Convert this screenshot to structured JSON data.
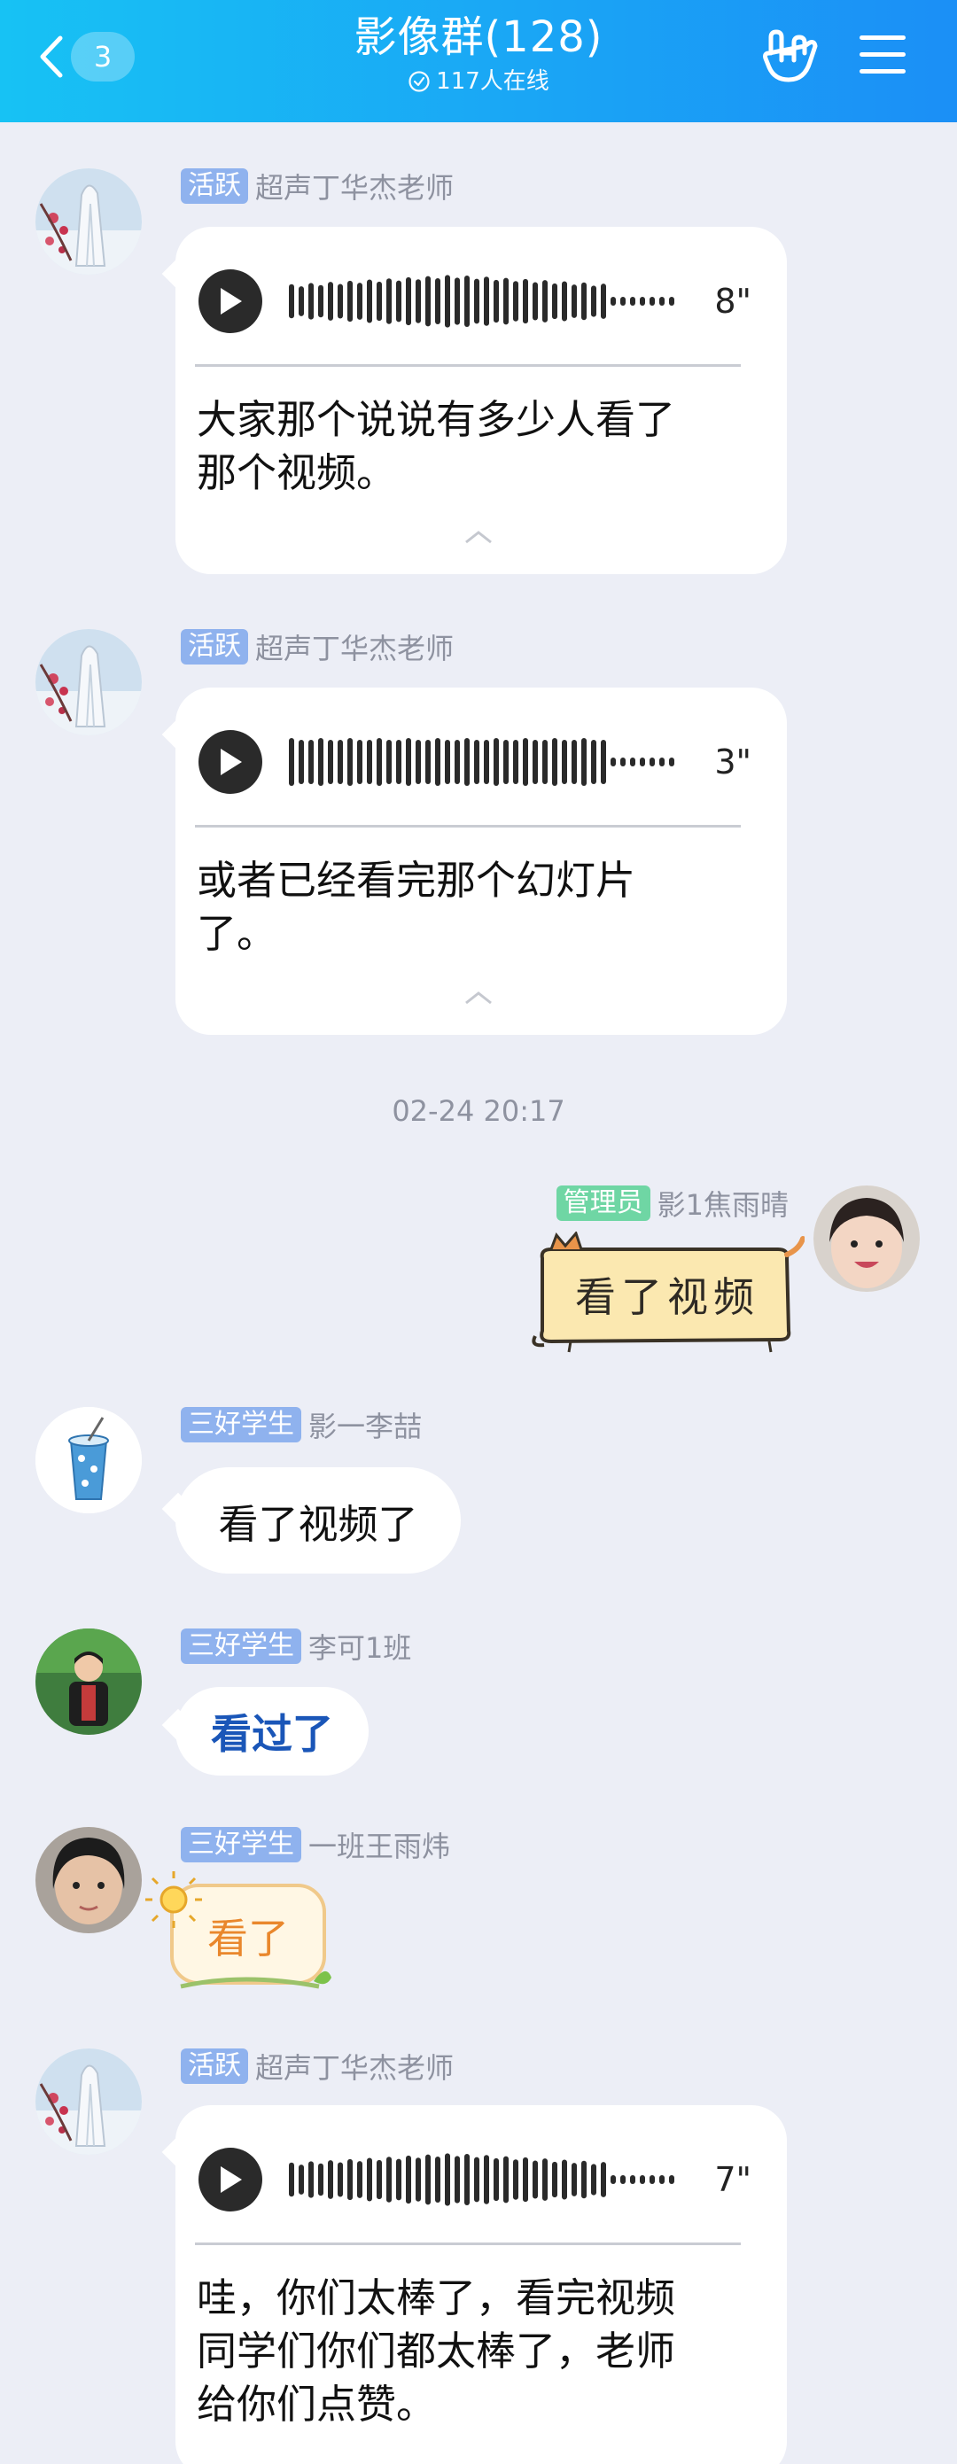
{
  "header": {
    "back_count": "3",
    "title": "影像群(128)",
    "online_status": "117人在线",
    "icons": {
      "back": "chevron-left-icon",
      "online": "check-circle-icon",
      "gesture": "hand-gesture-icon",
      "menu": "menu-icon"
    }
  },
  "colors": {
    "header_start": "#17c2f4",
    "header_end": "#1b8ff6",
    "tag_active": "#8fb2ee",
    "tag_admin": "#6fd6a4",
    "background": "#eceef6"
  },
  "messages": [
    {
      "tag": "活跃",
      "sender": "超声丁华杰老师",
      "type": "voice",
      "duration": "8\"",
      "transcript_lines": [
        "大家那个说说有多少人看了",
        "那个视频。"
      ]
    },
    {
      "tag": "活跃",
      "sender": "超声丁华杰老师",
      "type": "voice",
      "duration": "3\"",
      "transcript_lines": [
        "或者已经看完那个幻灯片",
        "了。"
      ]
    },
    {
      "type": "timestamp",
      "text": "02-24 20:17"
    },
    {
      "tag": "管理员",
      "sender": "影1焦雨晴",
      "type": "sticker_text",
      "text": "看了视频"
    },
    {
      "tag": "三好学生",
      "sender": "影一李喆",
      "type": "text",
      "text": "看了视频了"
    },
    {
      "tag": "三好学生",
      "sender": "李可1班",
      "type": "text",
      "text": "看过了"
    },
    {
      "tag": "三好学生",
      "sender": "一班王雨炜",
      "type": "sticker_text",
      "text": "看了"
    },
    {
      "tag": "活跃",
      "sender": "超声丁华杰老师",
      "type": "voice",
      "duration": "7\"",
      "transcript_lines": [
        "哇，你们太棒了，看完视频",
        "同学们你们都太棒了，老师",
        "给你们点赞。"
      ]
    }
  ]
}
